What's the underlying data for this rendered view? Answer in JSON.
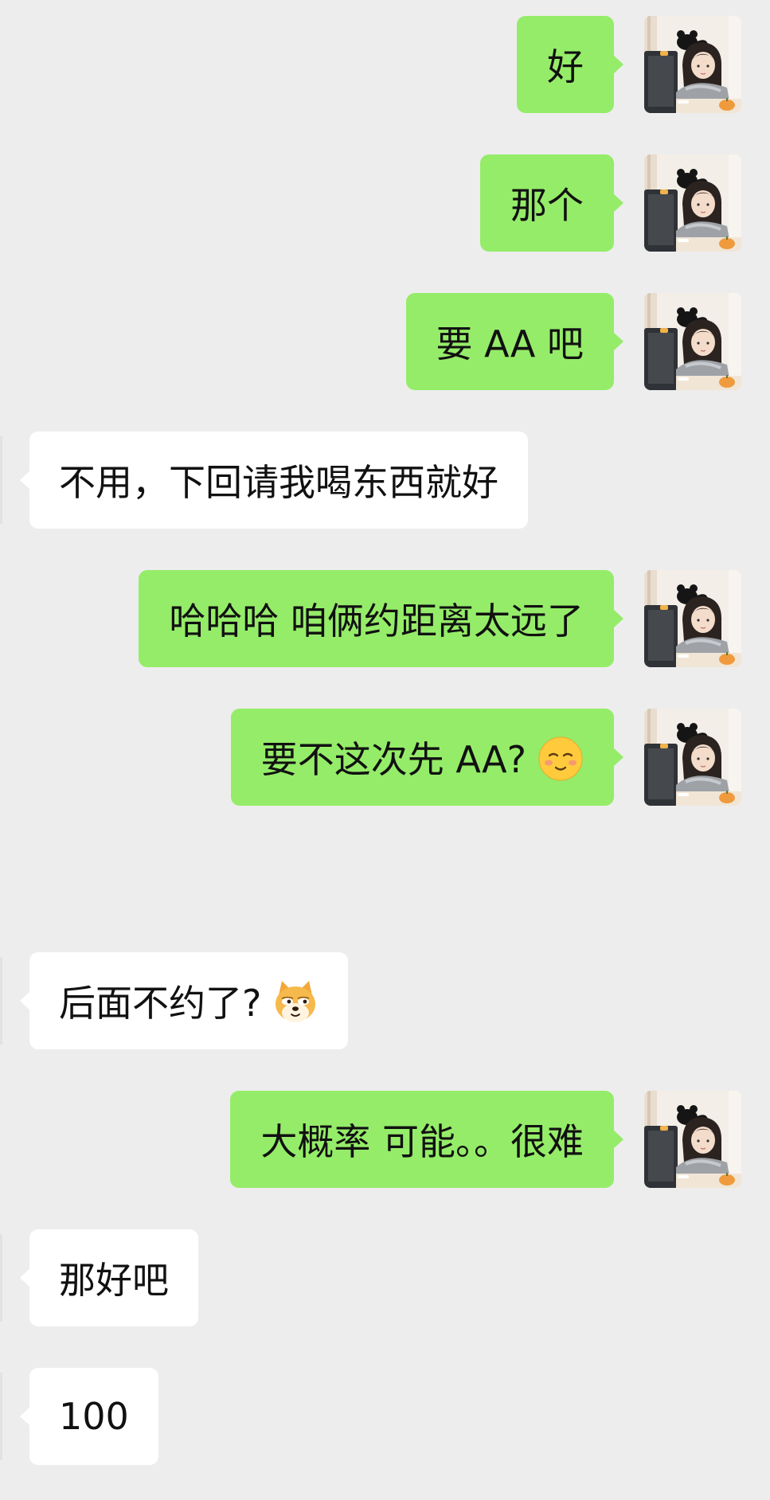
{
  "chat": {
    "messages": [
      {
        "sender": "me",
        "text": "好"
      },
      {
        "sender": "me",
        "text": "那个"
      },
      {
        "sender": "me",
        "text": "要 AA 吧"
      },
      {
        "sender": "other",
        "text": "不用，下回请我喝东西就好"
      },
      {
        "sender": "me",
        "text": "哈哈哈 咱俩约距离太远了"
      },
      {
        "sender": "me",
        "text": "要不这次先 AA?",
        "emoji": "blushing-smile-emoji"
      },
      {
        "sender": "other",
        "text": "后面不约了?",
        "emoji": "doge-emoji"
      },
      {
        "sender": "me",
        "text": "大概率 可能。。很难"
      },
      {
        "sender": "other",
        "text": "那好吧"
      },
      {
        "sender": "other",
        "text": "100"
      }
    ]
  },
  "colors": {
    "background": "#ededed",
    "outgoing_bubble": "#95ec69",
    "incoming_bubble": "#ffffff",
    "text": "#111111"
  },
  "icons": {
    "avatar": "user-avatar-illustration"
  }
}
